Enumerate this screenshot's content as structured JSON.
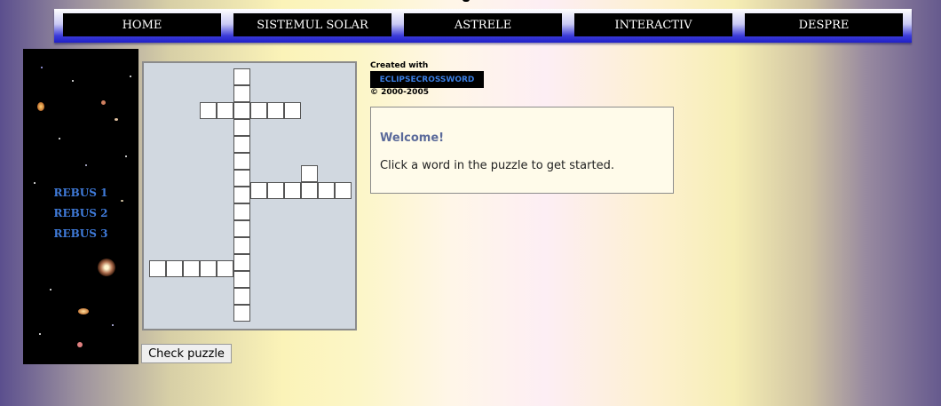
{
  "nav": {
    "items": [
      {
        "label": "HOME"
      },
      {
        "label": "SISTEMUL SOLAR"
      },
      {
        "label": "ASTRELE"
      },
      {
        "label": "INTERACTIV"
      },
      {
        "label": "DESPRE"
      }
    ]
  },
  "sidebar": {
    "items": [
      {
        "label": "REBUS 1"
      },
      {
        "label": "REBUS 2"
      },
      {
        "label": "REBUS 3"
      }
    ]
  },
  "credits": {
    "created_with": "Created with",
    "logo": "ECLIPSECROSSWORD",
    "copyright": "© 2000-2005"
  },
  "welcome": {
    "title": "Welcome!",
    "text": "Click a word in the puzzle to get started."
  },
  "actions": {
    "check_label": "Check puzzle"
  },
  "colors": {
    "nav_bar": "#3b3bd8",
    "link_blue": "#3f7ad8",
    "grid_background": "#d1d8e0"
  }
}
